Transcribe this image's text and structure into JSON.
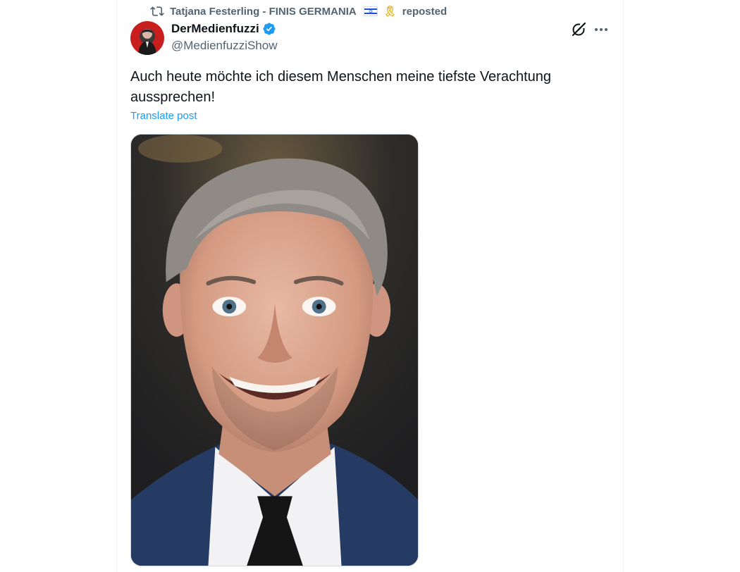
{
  "repost": {
    "user": "Tatjana Festerling - FINIS GERMANIA",
    "label": "reposted",
    "icon": "repost-icon"
  },
  "author": {
    "display_name": "DerMedienfuzzi",
    "handle": "@MedienfuzziShow",
    "verified": true
  },
  "post": {
    "text": "Auch heute möchte ich diesem Menschen meine tiefste Verachtung aussprechen!",
    "translate_label": "Translate post"
  },
  "colors": {
    "accent": "#1d9bf0",
    "secondary_text": "#536471",
    "primary_text": "#0f1419"
  }
}
